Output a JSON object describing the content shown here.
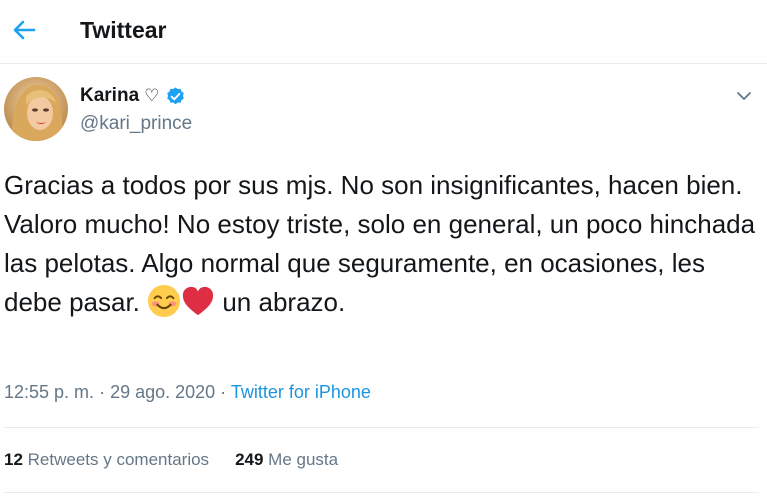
{
  "header": {
    "title": "Twittear",
    "back_icon": "arrow-left-icon"
  },
  "user": {
    "display_name": "Karina",
    "name_suffix": "♡",
    "handle": "@kari_prince",
    "verified": true,
    "verified_color": "#1da1f2"
  },
  "tweet": {
    "text_part1": "Gracias a todos por sus mjs. No son insignificantes, hacen bien. Valoro mucho! No estoy triste, solo en general, un poco hinchada las pelotas. Algo normal que seguramente, en ocasiones, les debe pasar. ",
    "emojis": [
      "smiling-face-icon",
      "red-heart-icon"
    ],
    "text_part2": " un abrazo.",
    "time": "12:55 p. m.",
    "separator": " · ",
    "date": "29 ago. 2020",
    "source": "Twitter for iPhone"
  },
  "stats": {
    "retweets_count": "12",
    "retweets_label": " Retweets y comentarios",
    "likes_count": "249",
    "likes_label": " Me gusta"
  },
  "colors": {
    "accent": "#1da1f2",
    "link": "#1b95e0",
    "muted": "#657786",
    "border": "#e6ecf0"
  }
}
